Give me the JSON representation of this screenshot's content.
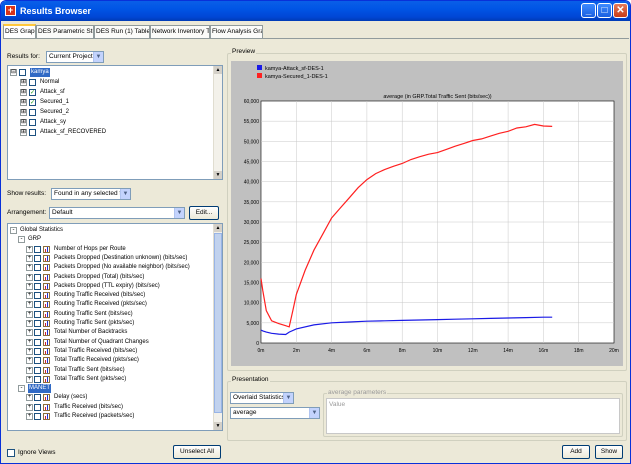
{
  "window": {
    "title": "Results Browser",
    "close_glyph": "✕",
    "max_glyph": "□",
    "min_glyph": "_",
    "app_glyph": "+"
  },
  "tabs": [
    {
      "label": "DES Graphs",
      "active": true
    },
    {
      "label": "DES Parametric Studies",
      "active": false
    },
    {
      "label": "DES Run (1) Tables",
      "active": false
    },
    {
      "label": "Network Inventory Tables",
      "active": false
    },
    {
      "label": "Flow Analysis Graphs",
      "active": false
    }
  ],
  "left": {
    "results_for_label": "Results for:",
    "results_for_value": "Current Project",
    "scenarios": [
      {
        "label": "kamya",
        "level": 0,
        "expander": "⊟",
        "checked": false,
        "selected": true
      },
      {
        "label": "Normal",
        "level": 1,
        "expander": "⊞",
        "checked": false,
        "selected": false
      },
      {
        "label": "Attack_sf",
        "level": 1,
        "expander": "⊞",
        "checked": true,
        "selected": false
      },
      {
        "label": "Secured_1",
        "level": 1,
        "expander": "⊞",
        "checked": true,
        "selected": false
      },
      {
        "label": "Secured_2",
        "level": 1,
        "expander": "⊞",
        "checked": false,
        "selected": false
      },
      {
        "label": "Attack_sy",
        "level": 1,
        "expander": "⊞",
        "checked": false,
        "selected": false
      },
      {
        "label": "Attack_sf_RECOVERED",
        "level": 1,
        "expander": "⊞",
        "checked": false,
        "selected": false
      }
    ],
    "show_results_label": "Show results:",
    "show_results_value": "Found in any selected files",
    "arrangement_label": "Arrangement:",
    "arrangement_value": "Default",
    "edit_button": "Edit...",
    "stats_root": "Global Statistics",
    "stats_group": "GRP",
    "stats": [
      "Number of Hops per Route",
      "Packets Dropped (Destination unknown) (bits/sec)",
      "Packets Dropped (No available neighbor) (bits/sec)",
      "Packets Dropped (Total) (bits/sec)",
      "Packets Dropped (TTL expiry) (bits/sec)",
      "Routing Traffic Received (bits/sec)",
      "Routing Traffic Received (pkts/sec)",
      "Routing Traffic Sent (bits/sec)",
      "Routing Traffic Sent (pkts/sec)",
      "Total Number of Backtracks",
      "Total Number of Quadrant Changes",
      "Total Traffic Received (bits/sec)",
      "Total Traffic Received (pkts/sec)",
      "Total Traffic Sent (bits/sec)",
      "Total Traffic Sent (pkts/sec)"
    ],
    "stats_group2": "MANET",
    "stats2": [
      "Delay (secs)",
      "Traffic Received (bits/sec)",
      "Traffic Received (packets/sec)"
    ],
    "ignore_views_label": "Ignore Views",
    "unselect_all_button": "Unselect All"
  },
  "preview": {
    "label": "Preview"
  },
  "presentation": {
    "label": "Presentation",
    "type_value": "Overlaid Statistics",
    "filter_value": "average",
    "params_label": "average parameters",
    "value_label": "Value"
  },
  "footer": {
    "add_button": "Add",
    "show_button": "Show"
  },
  "colors": {
    "series1": "#1a1ae6",
    "series2": "#ff2020",
    "plot_bg": "#ffffff",
    "frame_bg": "#c0c0c0"
  },
  "chart_data": {
    "type": "line",
    "title": "average (in GRP.Total Traffic Sent (bits/sec))",
    "xlabel": "",
    "ylabel": "",
    "x_unit": "minutes",
    "xlim": [
      0,
      20
    ],
    "ylim": [
      0,
      60000
    ],
    "x_ticks": [
      "0m",
      "2m",
      "4m",
      "6m",
      "8m",
      "10m",
      "12m",
      "14m",
      "16m",
      "18m",
      "20m"
    ],
    "y_ticks": [
      "0",
      "5,000",
      "10,000",
      "15,000",
      "20,000",
      "25,000",
      "30,000",
      "35,000",
      "40,000",
      "45,000",
      "50,000",
      "55,000",
      "60,000"
    ],
    "grid": true,
    "legend_position": "top-left",
    "series": [
      {
        "name": "kamya-Attack_sf-DES-1",
        "color": "#1a1ae6",
        "x": [
          0,
          0.1,
          0.3,
          0.6,
          1.0,
          1.4,
          1.6,
          2.0,
          3.0,
          4.0,
          5.0,
          6.0,
          7.0,
          8.0,
          9.0,
          10.0,
          11.0,
          12.0,
          13.0,
          14.0,
          15.0,
          16.0,
          16.5
        ],
        "y": [
          3200,
          3000,
          2700,
          2400,
          2200,
          2100,
          2700,
          3500,
          4500,
          5000,
          5200,
          5400,
          5500,
          5600,
          5700,
          5800,
          5900,
          6000,
          6100,
          6200,
          6300,
          6400,
          6400
        ]
      },
      {
        "name": "kamya-Secured_1-DES-1",
        "color": "#ff2020",
        "x": [
          0,
          0.1,
          0.3,
          0.6,
          1.0,
          1.4,
          1.6,
          1.8,
          2.0,
          2.5,
          3.0,
          3.5,
          4.0,
          4.5,
          5.0,
          5.5,
          6.0,
          6.5,
          7.0,
          7.5,
          8.0,
          8.5,
          9.0,
          9.5,
          10.0,
          10.5,
          11.0,
          11.5,
          12.0,
          12.5,
          13.0,
          13.5,
          14.0,
          14.5,
          15.0,
          15.5,
          16.0,
          16.5
        ],
        "y": [
          16000,
          13000,
          8000,
          5500,
          4800,
          4300,
          4000,
          8000,
          12000,
          18000,
          23000,
          27000,
          31000,
          33500,
          36000,
          38500,
          40500,
          42000,
          43000,
          43800,
          44500,
          45500,
          46200,
          46800,
          47200,
          48000,
          48800,
          49500,
          50200,
          50600,
          51300,
          52000,
          52500,
          53300,
          53600,
          54200,
          53800,
          53700
        ]
      }
    ]
  }
}
